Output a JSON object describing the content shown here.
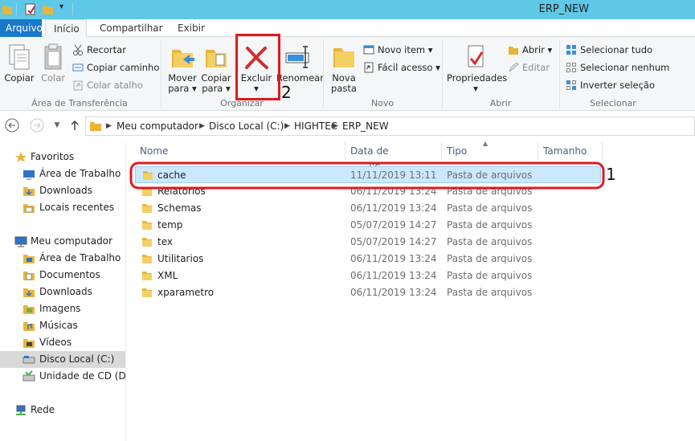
{
  "window": {
    "title": "ERP_NEW"
  },
  "ribbon_tabs": [
    "Arquivo",
    "Início",
    "Compartilhar",
    "Exibir"
  ],
  "ribbon": {
    "clipboard": {
      "copy": "Copiar",
      "paste": "Colar",
      "cut": "Recortar",
      "copy_path": "Copiar caminho",
      "paste_shortcut": "Colar atalho",
      "label": "Área de Transferência"
    },
    "organize": {
      "move_to_1": "Mover",
      "move_to_2": "para",
      "copy_to_1": "Copiar",
      "copy_to_2": "para",
      "delete": "Excluir",
      "rename": "Renomear",
      "label": "Organizar"
    },
    "new": {
      "new_folder_1": "Nova",
      "new_folder_2": "pasta",
      "new_item": "Novo item",
      "easy_access": "Fácil acesso",
      "label": "Novo"
    },
    "open": {
      "properties": "Propriedades",
      "open": "Abrir",
      "edit": "Editar",
      "label": "Abrir"
    },
    "select": {
      "select_all": "Selecionar tudo",
      "select_none": "Selecionar nenhum",
      "invert": "Inverter seleção",
      "label": "Selecionar"
    }
  },
  "address": {
    "crumbs": [
      "Meu computador",
      "Disco Local (C:)",
      "HIGHTEC",
      "ERP_NEW"
    ]
  },
  "nav": {
    "favorites": "Favoritos",
    "fav_items": [
      "Área de Trabalho",
      "Downloads",
      "Locais recentes"
    ],
    "computer": "Meu computador",
    "comp_items": [
      "Área de Trabalho",
      "Documentos",
      "Downloads",
      "Imagens",
      "Músicas",
      "Vídeos",
      "Disco Local (C:)",
      "Unidade de CD (D:) I"
    ],
    "network": "Rede"
  },
  "columns": {
    "name": "Nome",
    "date": "Data de modificaç...",
    "type": "Tipo",
    "size": "Tamanho"
  },
  "files": [
    {
      "name": "cache",
      "date": "11/11/2019 13:11",
      "type": "Pasta de arquivos"
    },
    {
      "name": "Relatorios",
      "date": "06/11/2019 13:24",
      "type": "Pasta de arquivos"
    },
    {
      "name": "Schemas",
      "date": "06/11/2019 13:24",
      "type": "Pasta de arquivos"
    },
    {
      "name": "temp",
      "date": "05/07/2019 14:27",
      "type": "Pasta de arquivos"
    },
    {
      "name": "tex",
      "date": "05/07/2019 14:27",
      "type": "Pasta de arquivos"
    },
    {
      "name": "Utilitarios",
      "date": "06/11/2019 13:24",
      "type": "Pasta de arquivos"
    },
    {
      "name": "XML",
      "date": "06/11/2019 13:24",
      "type": "Pasta de arquivos"
    },
    {
      "name": "xparametro",
      "date": "06/11/2019 13:24",
      "type": "Pasta de arquivos"
    }
  ],
  "annotations": {
    "first": "1",
    "second": "2"
  },
  "colors": {
    "titlebar": "#5fc8e6",
    "file_tab": "#1979ca",
    "selection": "#cce8ff",
    "highlight_box": "#e0191f"
  }
}
